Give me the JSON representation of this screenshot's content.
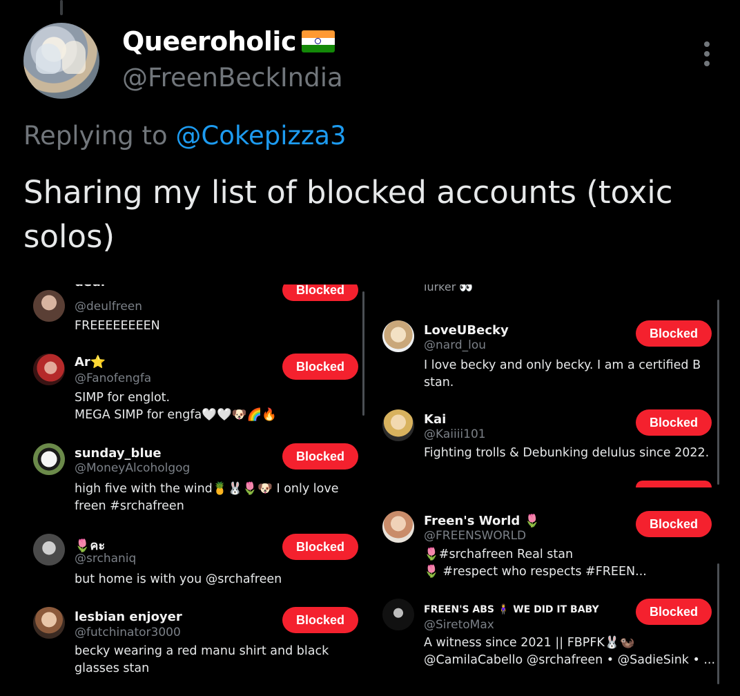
{
  "tweet": {
    "display_name": "Queeroholic",
    "flag_icon": "india-flag-icon",
    "handle": "@FreenBeckIndia",
    "replying_prefix": "Replying to",
    "replying_to": "@Cokepizza3",
    "text": "Sharing my list of blocked accounts (toxic solos)"
  },
  "colors": {
    "blocked_button": "#f4212e",
    "mention": "#1d9bf0",
    "muted": "#71767b",
    "background": "#000000"
  },
  "left_list": {
    "cut_name": "deul",
    "items": [
      {
        "name": "",
        "handle": "@deulfreen",
        "bio": "FREEEEEEEEN",
        "button": "Blocked"
      },
      {
        "name": "Ar⭐",
        "handle": "@Fanofengfa",
        "bio": "SIMP for englot.\nMEGA SIMP for engfa🤍🤍🐶🌈🔥",
        "button": "Blocked"
      },
      {
        "name": "sunday_blue",
        "handle": "@MoneyAlcoholgog",
        "bio": "high five with the wind🍍🐰🌷🐶  I only love\nfreen #srchafreen",
        "button": "Blocked"
      },
      {
        "name": "🌷คะ",
        "handle": "@srchaniq",
        "bio": "but home is with you @srchafreen",
        "button": "Blocked"
      },
      {
        "name": "lesbian enjoyer",
        "handle": "@futchinator3000",
        "bio": "becky wearing a red manu shirt and black\nglasses stan",
        "button": "Blocked"
      }
    ]
  },
  "right_top_list": {
    "cut_text": "lurker 👀",
    "items": [
      {
        "name": "LoveUBecky",
        "handle": "@nard_lou",
        "bio": "I love becky and only becky. I am a certified B\nstan.",
        "button": "Blocked"
      },
      {
        "name": "Kai",
        "handle": "@Kaiiii101",
        "bio": "Fighting trolls & Debunking delulus since 2022.",
        "button": "Blocked"
      }
    ]
  },
  "right_bottom_list": {
    "items": [
      {
        "name": "Freen's World 🌷",
        "handle": "@FREENSWORLD",
        "bio": "🌷#srchafreen Real stan\n🌷 #respect who respects #FREEN...",
        "button": "Blocked"
      },
      {
        "name": "FREEN'S ABS 🧍‍♀️ WE DID IT BABY",
        "handle": "@SiretoMax",
        "bio": "A witness since 2021 || FBPFK🐰🦦\n@CamilaCabello @srchafreen • @SadieSink • ...",
        "button": "Blocked"
      }
    ]
  }
}
